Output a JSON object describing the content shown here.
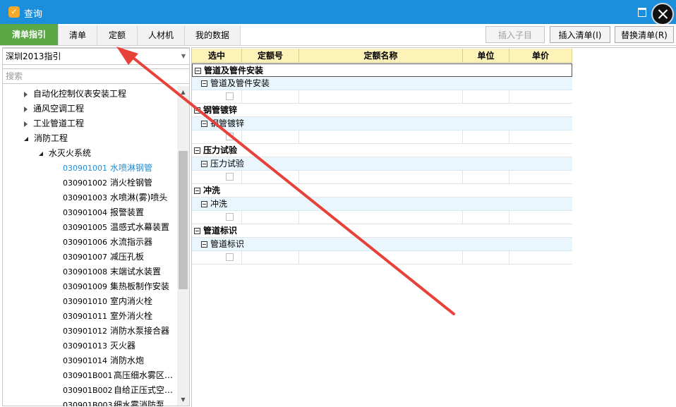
{
  "window": {
    "title": "查询",
    "app_icon": "app-logo-icon",
    "close_icon": "close-icon",
    "maximize_icon": "maximize-icon"
  },
  "tabs": [
    {
      "label": "清单指引",
      "active": true
    },
    {
      "label": "清单"
    },
    {
      "label": "定额"
    },
    {
      "label": "人材机"
    },
    {
      "label": "我的数据"
    }
  ],
  "toolbar": {
    "insert_child": "插入子目",
    "insert_list": "插入清单(I)",
    "replace_list": "替换清单(R)"
  },
  "left_panel": {
    "dropdown_value": "深圳2013指引",
    "search_placeholder": "搜索",
    "tree": [
      {
        "label": "自动化控制仪表安装工程",
        "level": 1,
        "state": "collapsed"
      },
      {
        "label": "通风空调工程",
        "level": 1,
        "state": "collapsed"
      },
      {
        "label": "工业管道工程",
        "level": 1,
        "state": "collapsed"
      },
      {
        "label": "消防工程",
        "level": 1,
        "state": "expanded"
      },
      {
        "label": "水灭火系统",
        "level": 2,
        "state": "expanded"
      },
      {
        "code": "030901001",
        "label": "水喷淋钢管",
        "level": 3,
        "selected": true
      },
      {
        "code": "030901002",
        "label": "消火栓钢管",
        "level": 3
      },
      {
        "code": "030901003",
        "label": "水喷淋(雾)喷头",
        "level": 3
      },
      {
        "code": "030901004",
        "label": "报警装置",
        "level": 3
      },
      {
        "code": "030901005",
        "label": "温感式水幕装置",
        "level": 3
      },
      {
        "code": "030901006",
        "label": "水流指示器",
        "level": 3
      },
      {
        "code": "030901007",
        "label": "减压孔板",
        "level": 3
      },
      {
        "code": "030901008",
        "label": "末端试水装置",
        "level": 3
      },
      {
        "code": "030901009",
        "label": "集热板制作安装",
        "level": 3
      },
      {
        "code": "030901010",
        "label": "室内消火栓",
        "level": 3
      },
      {
        "code": "030901011",
        "label": "室外消火栓",
        "level": 3
      },
      {
        "code": "030901012",
        "label": "消防水泵接合器",
        "level": 3
      },
      {
        "code": "030901013",
        "label": "灭火器",
        "level": 3
      },
      {
        "code": "030901014",
        "label": "消防水炮",
        "level": 3
      },
      {
        "code": "030901B001",
        "label": "高压细水雾区…",
        "level": 3
      },
      {
        "code": "030901B002",
        "label": "自给正压式空…",
        "level": 3
      },
      {
        "code": "030901B003",
        "label": "细水雾消防泵…",
        "level": 3
      }
    ]
  },
  "grid": {
    "columns": [
      "选中",
      "定额号",
      "定额名称",
      "单位",
      "单价"
    ],
    "groups": [
      {
        "title": "管道及管件安装",
        "sub": "管道及管件安装"
      },
      {
        "title": "钢管镀锌",
        "sub": "钢管镀锌"
      },
      {
        "title": "压力试验",
        "sub": "压力试验"
      },
      {
        "title": "冲洗",
        "sub": "冲洗"
      },
      {
        "title": "管道标识",
        "sub": "管道标识"
      }
    ]
  },
  "colors": {
    "title_bar": "#1c8fdc",
    "active_tab": "#5ca845",
    "header_bg": "#fdf2b8",
    "sub_row_bg": "#e9f6fd",
    "annotation_arrow": "#e8413a",
    "selected_item": "#1e8fd8"
  }
}
